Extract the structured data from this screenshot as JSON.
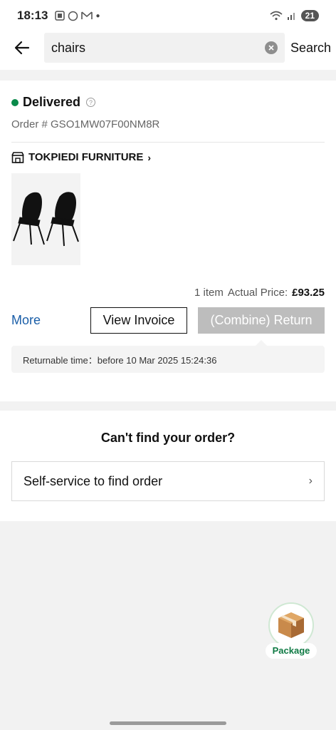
{
  "status_bar": {
    "time": "18:13",
    "battery": "21"
  },
  "search": {
    "value": "chairs",
    "button_label": "Search"
  },
  "order": {
    "status": "Delivered",
    "status_color": "#0a8a4a",
    "order_number": "Order # GSO1MW07F00NM8R",
    "store_name": "TOKPIEDI FURNITURE",
    "item_count": "1 item",
    "price_label": "Actual Price:",
    "price_value": "£93.25",
    "more_label": "More",
    "view_invoice_label": "View Invoice",
    "return_label": "(Combine) Return",
    "returnable_time": "Returnable time：before 10 Mar 2025 15:24:36"
  },
  "find_order": {
    "title": "Can't find your order?",
    "self_service_label": "Self-service to find order"
  },
  "fab": {
    "label": "Package"
  },
  "icons": [
    "back-arrow-icon",
    "clear-icon",
    "help-icon",
    "store-icon",
    "chevron-right-icon",
    "package-icon"
  ]
}
